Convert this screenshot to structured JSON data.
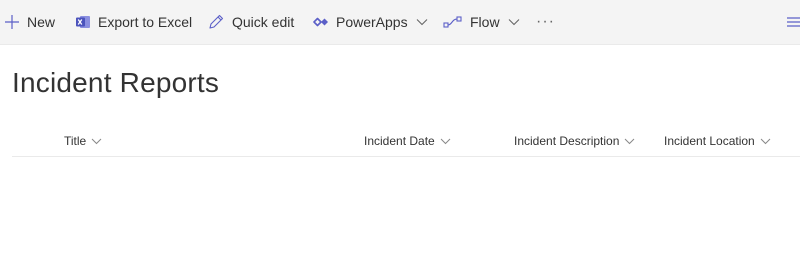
{
  "commandbar": {
    "new_label": "New",
    "export_label": "Export to Excel",
    "quickedit_label": "Quick edit",
    "powerapps_label": "PowerApps",
    "flow_label": "Flow",
    "more_glyph": "···"
  },
  "page": {
    "title": "Incident Reports"
  },
  "columns": [
    {
      "label": "Title"
    },
    {
      "label": "Incident Date"
    },
    {
      "label": "Incident Description"
    },
    {
      "label": "Incident Location"
    }
  ],
  "colors": {
    "accent": "#5b5fc7",
    "commandbar_bg": "#f4f4f4",
    "excel": "#4b53bc"
  },
  "icons": [
    "add-icon",
    "excel-icon",
    "pencil-icon",
    "powerapps-icon",
    "flow-icon",
    "chevron-down-icon",
    "more-icon",
    "view-options-icon"
  ]
}
